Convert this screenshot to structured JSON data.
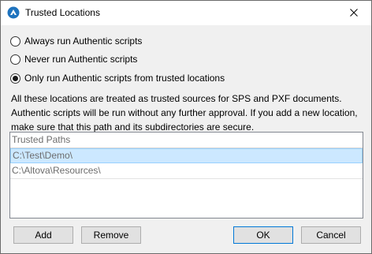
{
  "window": {
    "title": "Trusted Locations",
    "close_glyph": "✕"
  },
  "options": [
    {
      "label": "Always run Authentic scripts",
      "checked": false
    },
    {
      "label": "Never run Authentic scripts",
      "checked": false
    },
    {
      "label": "Only run Authentic scripts from trusted locations",
      "checked": true
    }
  ],
  "description": [
    "All these locations are treated as trusted sources for SPS and PXF documents.",
    "Authentic scripts will be run without any further approval. If you add a new location,",
    "make sure that this path and its subdirectories are secure."
  ],
  "trusted_paths": {
    "header": "Trusted Paths",
    "rows": [
      {
        "path": "C:\\Test\\Demo\\",
        "selected": true
      },
      {
        "path": "C:\\Altova\\Resources\\",
        "selected": false
      }
    ]
  },
  "buttons": {
    "add": "Add",
    "remove": "Remove",
    "ok": "OK",
    "cancel": "Cancel"
  },
  "colors": {
    "accent": "#0078d7",
    "selection": "#cce8ff"
  },
  "icons": {
    "app": "altova-app-icon",
    "close": "close-icon"
  }
}
